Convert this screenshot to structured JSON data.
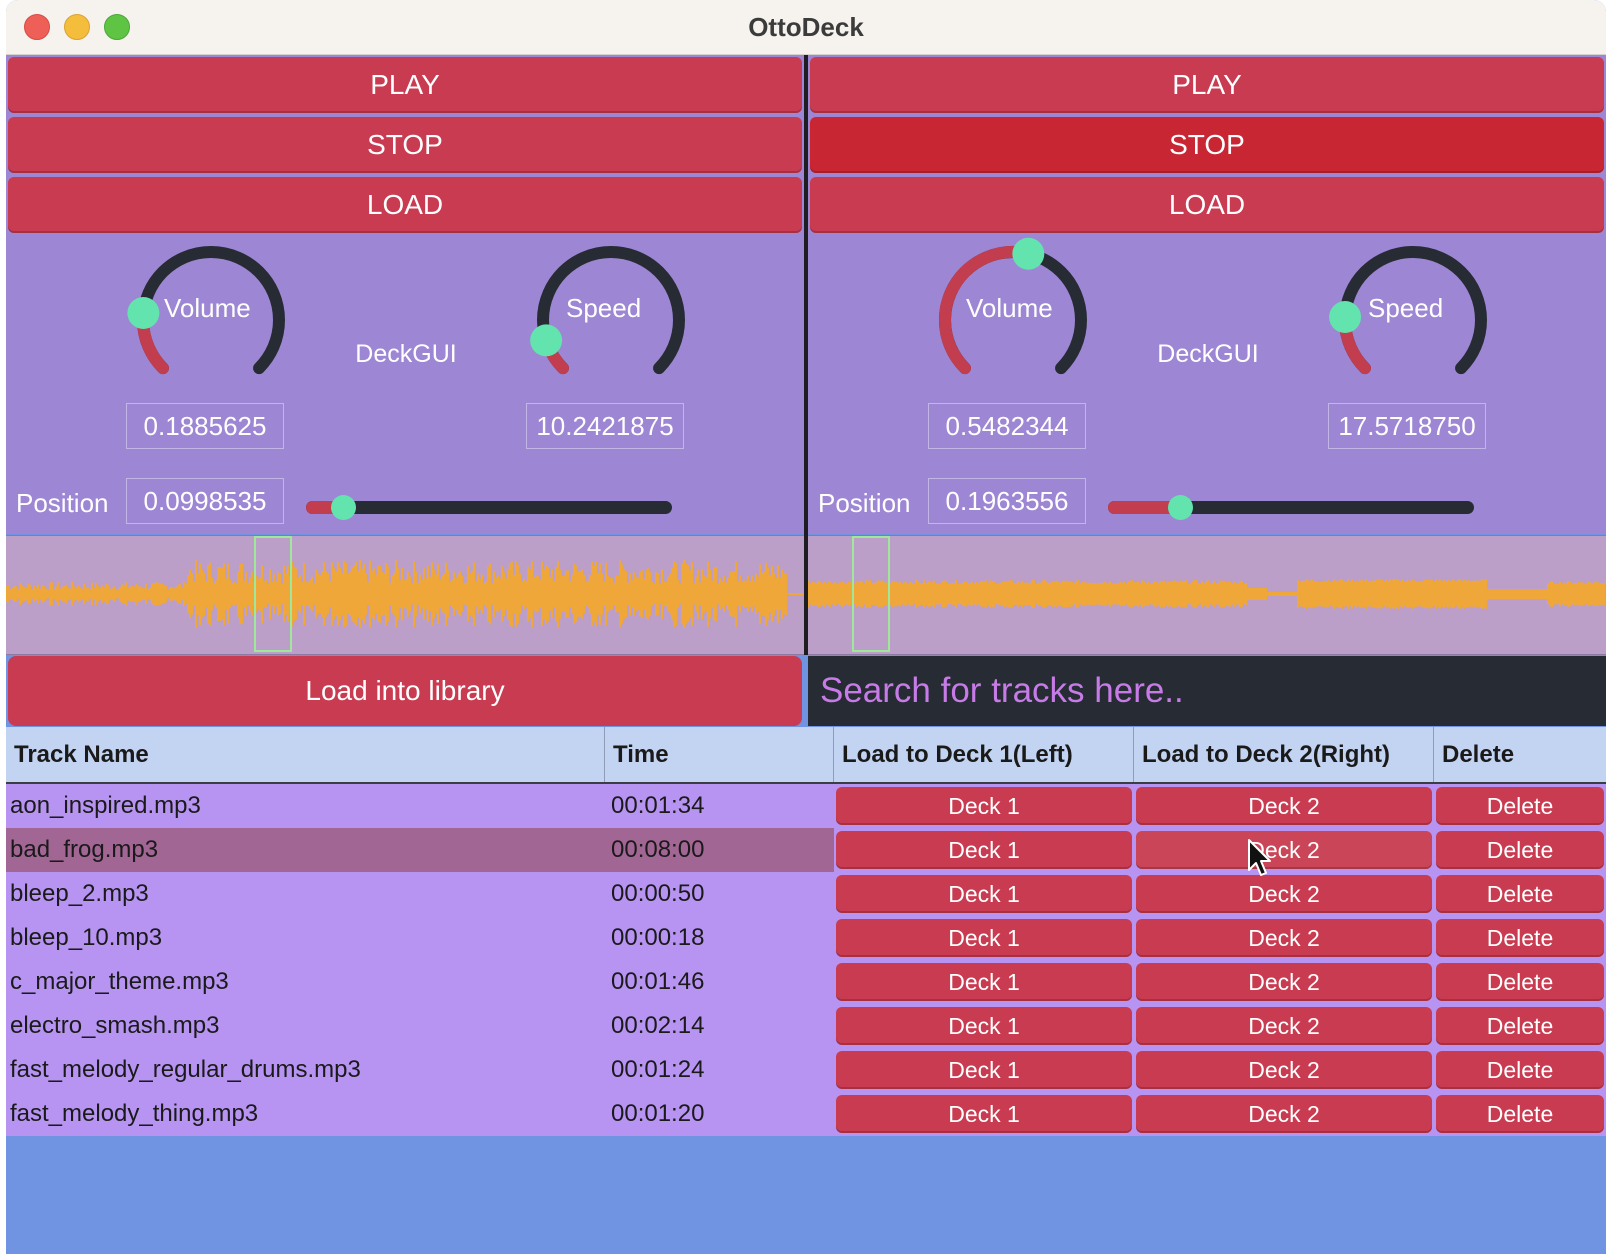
{
  "window": {
    "title": "OttoDeck"
  },
  "decks": [
    {
      "play_label": "PLAY",
      "stop_label": "STOP",
      "load_label": "LOAD",
      "volume_label": "Volume",
      "speed_label": "Speed",
      "center_label": "DeckGUI",
      "volume_value": "0.1885625",
      "speed_value": "10.2421875",
      "position_label": "Position",
      "position_value": "0.0998535",
      "volume_level": 0.1885625,
      "speed_level": 0.102,
      "position_level": 0.0998535
    },
    {
      "play_label": "PLAY",
      "stop_label": "STOP",
      "load_label": "LOAD",
      "volume_label": "Volume",
      "speed_label": "Speed",
      "center_label": "DeckGUI",
      "volume_value": "0.5482344",
      "speed_value": "17.5718750",
      "position_label": "Position",
      "position_value": "0.1963556",
      "volume_level": 0.5482344,
      "speed_level": 0.176,
      "position_level": 0.1963556
    }
  ],
  "library": {
    "load_button": "Load into library",
    "search_placeholder": "Search for tracks here.."
  },
  "table": {
    "headers": [
      "Track Name",
      "Time",
      "Load to Deck 1(Left)",
      "Load to Deck 2(Right)",
      "Delete"
    ],
    "deck1_label": "Deck 1",
    "deck2_label": "Deck 2",
    "delete_label": "Delete",
    "rows": [
      {
        "name": "aon_inspired.mp3",
        "time": "00:01:34"
      },
      {
        "name": "bad_frog.mp3",
        "time": "00:08:00"
      },
      {
        "name": "bleep_2.mp3",
        "time": "00:00:50"
      },
      {
        "name": "bleep_10.mp3",
        "time": "00:00:18"
      },
      {
        "name": "c_major_theme.mp3",
        "time": "00:01:46"
      },
      {
        "name": "electro_smash.mp3",
        "time": "00:02:14"
      },
      {
        "name": "fast_melody_regular_drums.mp3",
        "time": "00:01:24"
      },
      {
        "name": "fast_melody_thing.mp3",
        "time": "00:01:20"
      }
    ]
  },
  "colors": {
    "button": "#c93b50",
    "deck_bg": "#9d86d3",
    "knob_thumb": "#63e3ad",
    "waveform": "#f0a73a",
    "table_row": "#b794f2",
    "table_row_selected": "#a26694",
    "window_bg": "#7094e2"
  },
  "icons": [
    "close-icon",
    "minimize-icon",
    "maximize-icon",
    "mouse-cursor-icon"
  ]
}
